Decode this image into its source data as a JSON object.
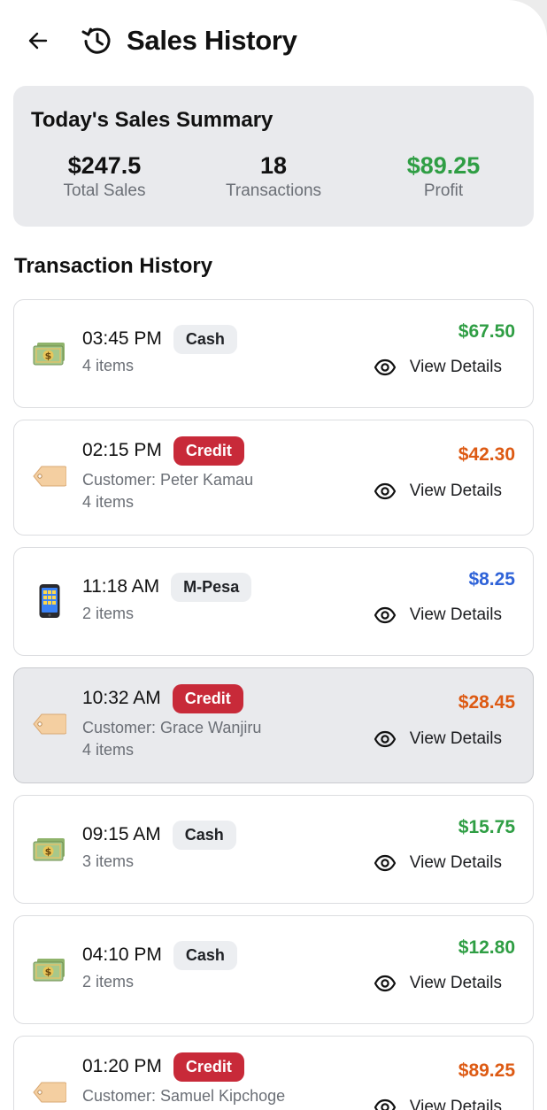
{
  "header": {
    "title": "Sales History",
    "back_icon": "arrow-left-icon",
    "title_icon": "history-clock-icon"
  },
  "summary": {
    "title": "Today's Sales Summary",
    "total_sales": {
      "value": "$247.5",
      "label": "Total Sales"
    },
    "transactions": {
      "value": "18",
      "label": "Transactions"
    },
    "profit": {
      "value": "$89.25",
      "label": "Profit",
      "color": "#2f9e44"
    }
  },
  "history": {
    "title": "Transaction History",
    "view_details_label": "View Details",
    "transactions": [
      {
        "icon": "money-bill-icon",
        "time": "03:45 PM",
        "method": "Cash",
        "customer": "",
        "items": "4 items",
        "amount": "$67.50",
        "amount_color": "#2f9e44",
        "selected": false
      },
      {
        "icon": "tag-icon",
        "time": "02:15 PM",
        "method": "Credit",
        "customer": "Customer: Peter Kamau",
        "items": "4 items",
        "amount": "$42.30",
        "amount_color": "#dd5a13",
        "selected": false
      },
      {
        "icon": "mobile-phone-icon",
        "time": "11:18 AM",
        "method": "M-Pesa",
        "customer": "",
        "items": "2 items",
        "amount": "$8.25",
        "amount_color": "#2f63d8",
        "selected": false
      },
      {
        "icon": "tag-icon",
        "time": "10:32 AM",
        "method": "Credit",
        "customer": "Customer: Grace Wanjiru",
        "items": "4 items",
        "amount": "$28.45",
        "amount_color": "#dd5a13",
        "selected": true
      },
      {
        "icon": "money-bill-icon",
        "time": "09:15 AM",
        "method": "Cash",
        "customer": "",
        "items": "3 items",
        "amount": "$15.75",
        "amount_color": "#2f9e44",
        "selected": false
      },
      {
        "icon": "money-bill-icon",
        "time": "04:10 PM",
        "method": "Cash",
        "customer": "",
        "items": "2 items",
        "amount": "$12.80",
        "amount_color": "#2f9e44",
        "selected": false
      },
      {
        "icon": "tag-icon",
        "time": "01:20 PM",
        "method": "Credit",
        "customer": "Customer: Samuel Kipchoge",
        "items": "",
        "amount": "$89.25",
        "amount_color": "#dd5a13",
        "selected": false
      }
    ]
  }
}
